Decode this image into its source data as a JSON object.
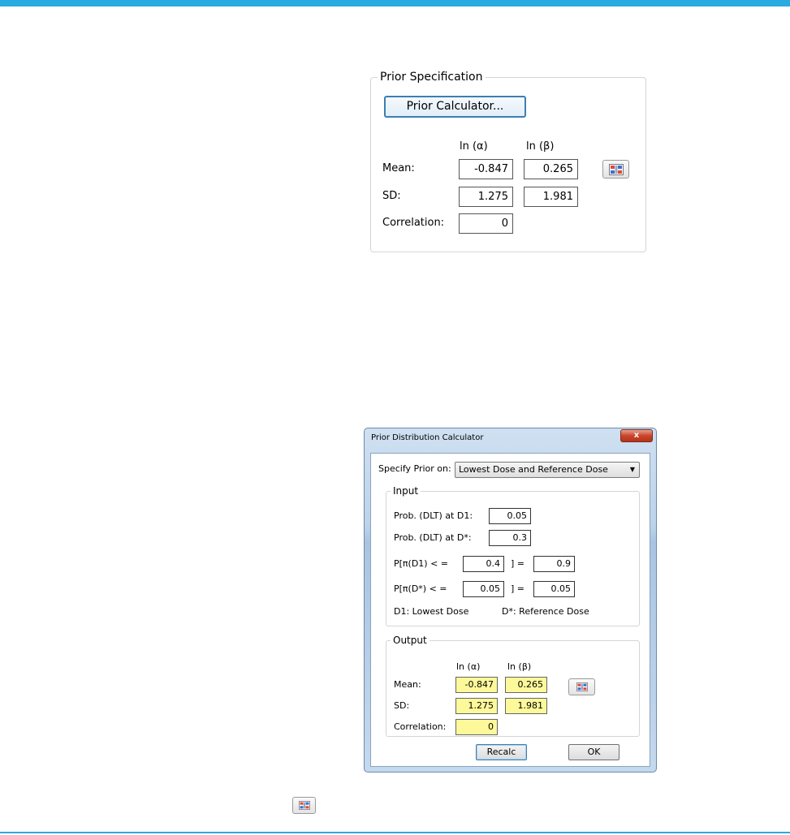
{
  "prior_spec": {
    "legend": "Prior Specification",
    "calc_button": "Prior Calculator...",
    "col_alpha": "ln (α)",
    "col_beta": "ln (β)",
    "mean_label": "Mean:",
    "sd_label": "SD:",
    "corr_label": "Correlation:",
    "mean_alpha": "-0.847",
    "mean_beta": "0.265",
    "sd_alpha": "1.275",
    "sd_beta": "1.981",
    "correlation": "0"
  },
  "dialog": {
    "title": "Prior Distribution Calculator",
    "close": "x",
    "specify_label": "Specify Prior on:",
    "specify_value": "Lowest Dose and Reference Dose",
    "input": {
      "legend": "Input",
      "prob_d1_label": "Prob. (DLT) at D1:",
      "prob_d1_value": "0.05",
      "prob_dstar_label": "Prob. (DLT) at D*:",
      "prob_dstar_value": "0.3",
      "p1_prefix": "P[π(D1) < =",
      "p1_bound": "0.4",
      "p1_eq": "] =",
      "p1_prob": "0.9",
      "p2_prefix": "P[π(D*) < =",
      "p2_bound": "0.05",
      "p2_eq": "] =",
      "p2_prob": "0.05",
      "note_d1": "D1: Lowest Dose",
      "note_dstar": "D*: Reference Dose"
    },
    "output": {
      "legend": "Output",
      "col_alpha": "ln (α)",
      "col_beta": "ln (β)",
      "mean_label": "Mean:",
      "sd_label": "SD:",
      "corr_label": "Correlation:",
      "mean_alpha": "-0.847",
      "mean_beta": "0.265",
      "sd_alpha": "1.275",
      "sd_beta": "1.981",
      "correlation": "0"
    },
    "recalc_button": "Recalc",
    "ok_button": "OK"
  },
  "icons": {
    "matrix_icon": "matrix-grid-icon"
  }
}
